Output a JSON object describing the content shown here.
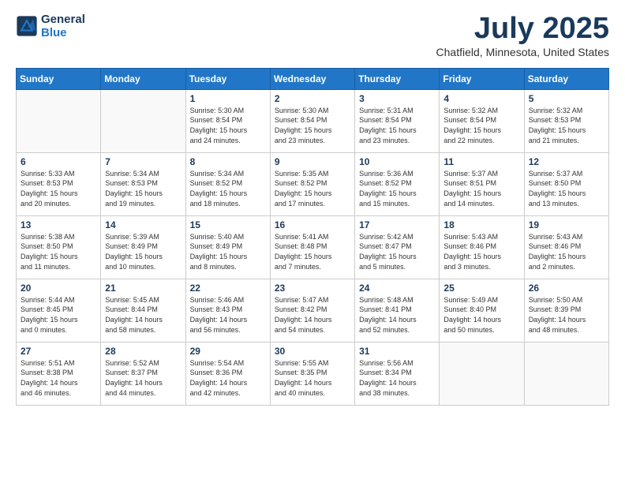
{
  "logo": {
    "line1": "General",
    "line2": "Blue"
  },
  "title": "July 2025",
  "subtitle": "Chatfield, Minnesota, United States",
  "weekdays": [
    "Sunday",
    "Monday",
    "Tuesday",
    "Wednesday",
    "Thursday",
    "Friday",
    "Saturday"
  ],
  "weeks": [
    [
      {
        "day": "",
        "info": ""
      },
      {
        "day": "",
        "info": ""
      },
      {
        "day": "1",
        "info": "Sunrise: 5:30 AM\nSunset: 8:54 PM\nDaylight: 15 hours\nand 24 minutes."
      },
      {
        "day": "2",
        "info": "Sunrise: 5:30 AM\nSunset: 8:54 PM\nDaylight: 15 hours\nand 23 minutes."
      },
      {
        "day": "3",
        "info": "Sunrise: 5:31 AM\nSunset: 8:54 PM\nDaylight: 15 hours\nand 23 minutes."
      },
      {
        "day": "4",
        "info": "Sunrise: 5:32 AM\nSunset: 8:54 PM\nDaylight: 15 hours\nand 22 minutes."
      },
      {
        "day": "5",
        "info": "Sunrise: 5:32 AM\nSunset: 8:53 PM\nDaylight: 15 hours\nand 21 minutes."
      }
    ],
    [
      {
        "day": "6",
        "info": "Sunrise: 5:33 AM\nSunset: 8:53 PM\nDaylight: 15 hours\nand 20 minutes."
      },
      {
        "day": "7",
        "info": "Sunrise: 5:34 AM\nSunset: 8:53 PM\nDaylight: 15 hours\nand 19 minutes."
      },
      {
        "day": "8",
        "info": "Sunrise: 5:34 AM\nSunset: 8:52 PM\nDaylight: 15 hours\nand 18 minutes."
      },
      {
        "day": "9",
        "info": "Sunrise: 5:35 AM\nSunset: 8:52 PM\nDaylight: 15 hours\nand 17 minutes."
      },
      {
        "day": "10",
        "info": "Sunrise: 5:36 AM\nSunset: 8:52 PM\nDaylight: 15 hours\nand 15 minutes."
      },
      {
        "day": "11",
        "info": "Sunrise: 5:37 AM\nSunset: 8:51 PM\nDaylight: 15 hours\nand 14 minutes."
      },
      {
        "day": "12",
        "info": "Sunrise: 5:37 AM\nSunset: 8:50 PM\nDaylight: 15 hours\nand 13 minutes."
      }
    ],
    [
      {
        "day": "13",
        "info": "Sunrise: 5:38 AM\nSunset: 8:50 PM\nDaylight: 15 hours\nand 11 minutes."
      },
      {
        "day": "14",
        "info": "Sunrise: 5:39 AM\nSunset: 8:49 PM\nDaylight: 15 hours\nand 10 minutes."
      },
      {
        "day": "15",
        "info": "Sunrise: 5:40 AM\nSunset: 8:49 PM\nDaylight: 15 hours\nand 8 minutes."
      },
      {
        "day": "16",
        "info": "Sunrise: 5:41 AM\nSunset: 8:48 PM\nDaylight: 15 hours\nand 7 minutes."
      },
      {
        "day": "17",
        "info": "Sunrise: 5:42 AM\nSunset: 8:47 PM\nDaylight: 15 hours\nand 5 minutes."
      },
      {
        "day": "18",
        "info": "Sunrise: 5:43 AM\nSunset: 8:46 PM\nDaylight: 15 hours\nand 3 minutes."
      },
      {
        "day": "19",
        "info": "Sunrise: 5:43 AM\nSunset: 8:46 PM\nDaylight: 15 hours\nand 2 minutes."
      }
    ],
    [
      {
        "day": "20",
        "info": "Sunrise: 5:44 AM\nSunset: 8:45 PM\nDaylight: 15 hours\nand 0 minutes."
      },
      {
        "day": "21",
        "info": "Sunrise: 5:45 AM\nSunset: 8:44 PM\nDaylight: 14 hours\nand 58 minutes."
      },
      {
        "day": "22",
        "info": "Sunrise: 5:46 AM\nSunset: 8:43 PM\nDaylight: 14 hours\nand 56 minutes."
      },
      {
        "day": "23",
        "info": "Sunrise: 5:47 AM\nSunset: 8:42 PM\nDaylight: 14 hours\nand 54 minutes."
      },
      {
        "day": "24",
        "info": "Sunrise: 5:48 AM\nSunset: 8:41 PM\nDaylight: 14 hours\nand 52 minutes."
      },
      {
        "day": "25",
        "info": "Sunrise: 5:49 AM\nSunset: 8:40 PM\nDaylight: 14 hours\nand 50 minutes."
      },
      {
        "day": "26",
        "info": "Sunrise: 5:50 AM\nSunset: 8:39 PM\nDaylight: 14 hours\nand 48 minutes."
      }
    ],
    [
      {
        "day": "27",
        "info": "Sunrise: 5:51 AM\nSunset: 8:38 PM\nDaylight: 14 hours\nand 46 minutes."
      },
      {
        "day": "28",
        "info": "Sunrise: 5:52 AM\nSunset: 8:37 PM\nDaylight: 14 hours\nand 44 minutes."
      },
      {
        "day": "29",
        "info": "Sunrise: 5:54 AM\nSunset: 8:36 PM\nDaylight: 14 hours\nand 42 minutes."
      },
      {
        "day": "30",
        "info": "Sunrise: 5:55 AM\nSunset: 8:35 PM\nDaylight: 14 hours\nand 40 minutes."
      },
      {
        "day": "31",
        "info": "Sunrise: 5:56 AM\nSunset: 8:34 PM\nDaylight: 14 hours\nand 38 minutes."
      },
      {
        "day": "",
        "info": ""
      },
      {
        "day": "",
        "info": ""
      }
    ]
  ]
}
